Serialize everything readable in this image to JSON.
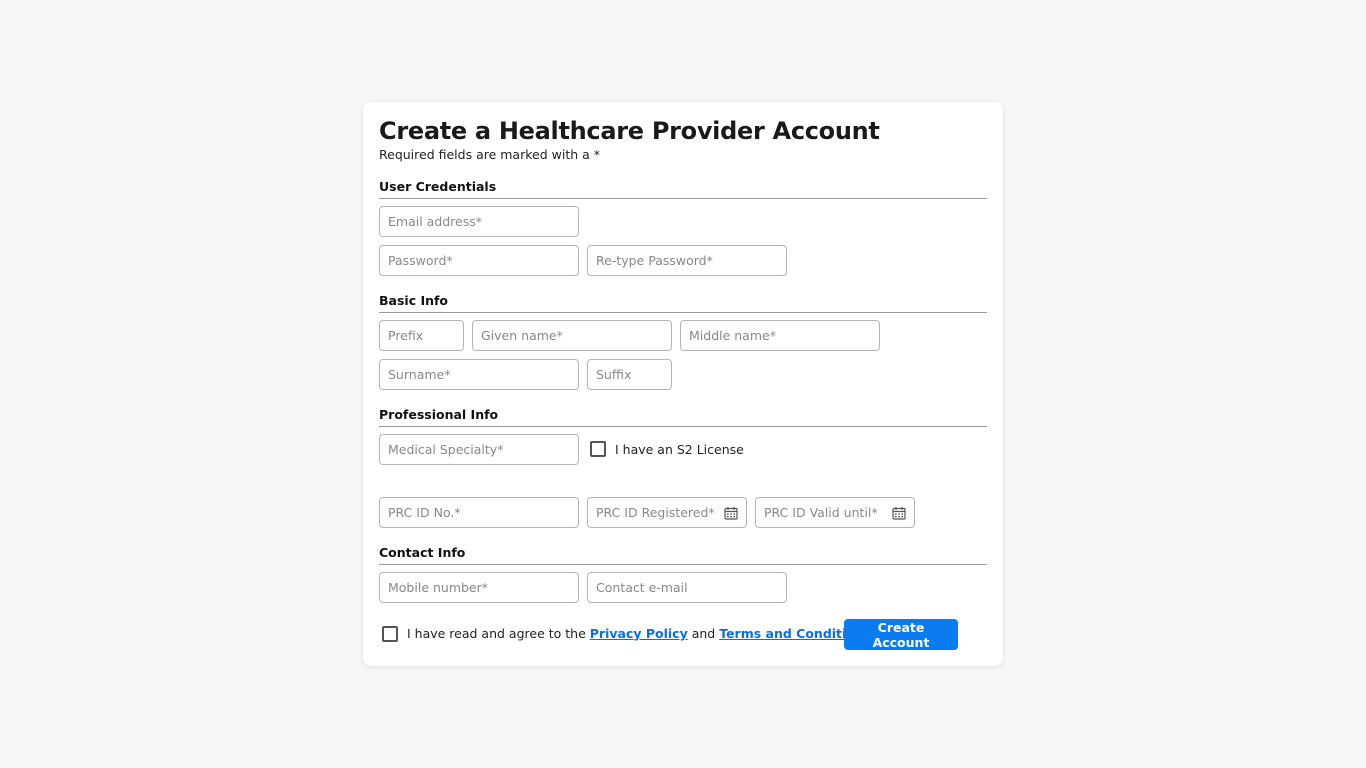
{
  "form": {
    "title": "Create a Healthcare Provider Account",
    "subtitle": "Required fields are marked with a *"
  },
  "sections": {
    "credentials": {
      "heading": "User Credentials",
      "email_placeholder": "Email address*",
      "password_placeholder": "Password*",
      "retype_password_placeholder": "Re-type Password*"
    },
    "basic_info": {
      "heading": "Basic Info",
      "prefix_placeholder": "Prefix",
      "given_name_placeholder": "Given name*",
      "middle_name_placeholder": "Middle name*",
      "surname_placeholder": "Surname*",
      "suffix_placeholder": "Suffix"
    },
    "professional_info": {
      "heading": "Professional Info",
      "specialty_placeholder": "Medical Specialty*",
      "s2_license_label": "I have an S2 License",
      "prc_id_placeholder": "PRC ID No.*",
      "prc_registered_placeholder": "PRC ID Registered*",
      "prc_valid_placeholder": "PRC ID Valid until*"
    },
    "contact_info": {
      "heading": "Contact Info",
      "mobile_placeholder": "Mobile number*",
      "contact_email_placeholder": "Contact e-mail"
    }
  },
  "agreement": {
    "prefix": "I have read and agree to the ",
    "privacy_link": "Privacy Policy",
    "conjunction": " and ",
    "terms_link": "Terms and Conditions",
    "suffix": "."
  },
  "submit_label": "Create Account",
  "colors": {
    "accent": "#0a7cf0",
    "link": "#0a6fd8",
    "background": "#f7f7f7"
  },
  "icons": {
    "date_picker": "calendar-icon"
  }
}
